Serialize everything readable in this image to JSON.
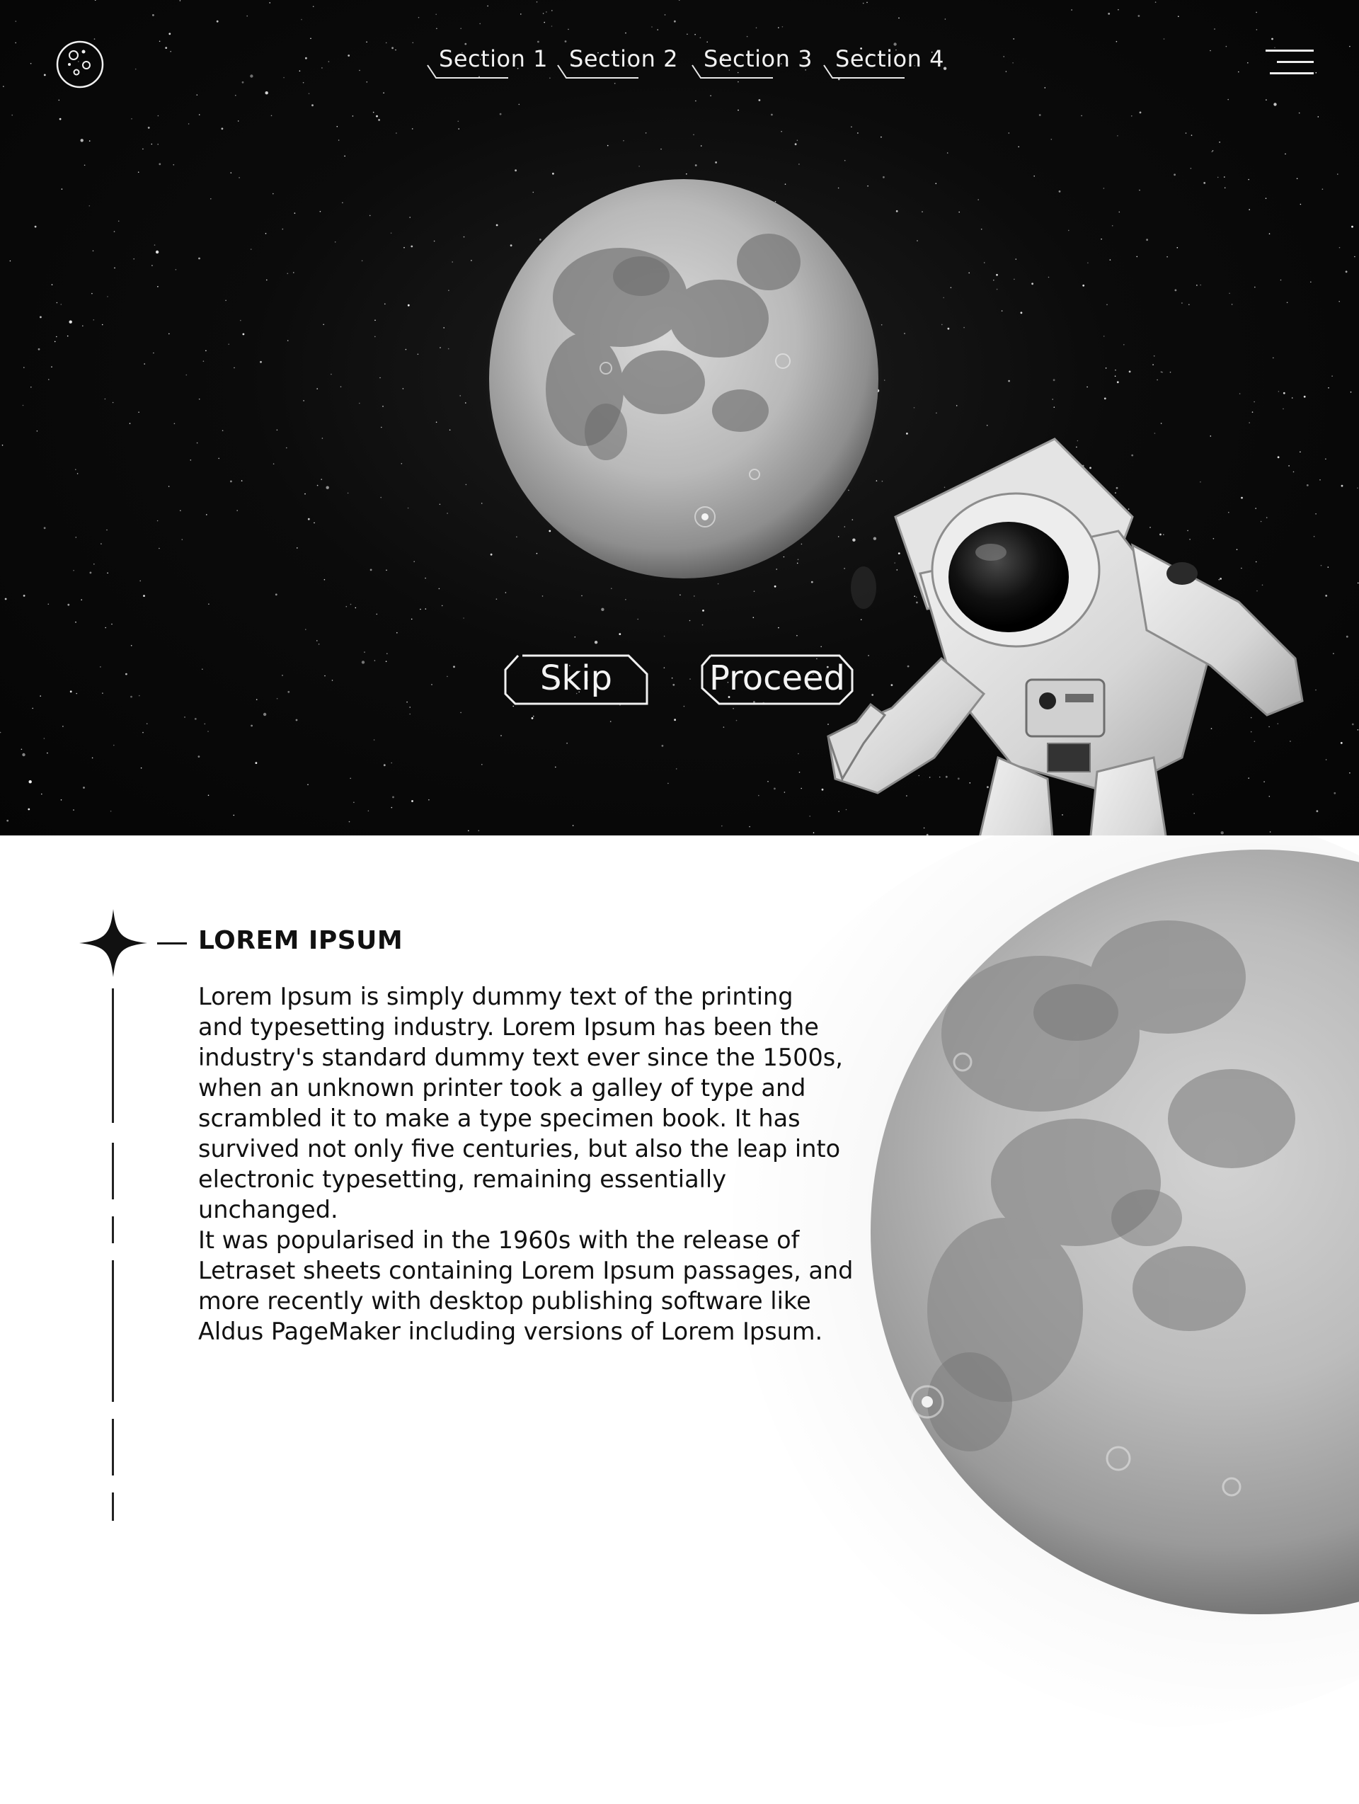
{
  "header": {
    "logo_icon": "moon-logo-icon",
    "nav": [
      {
        "label": "Section 1"
      },
      {
        "label": "Section 2"
      },
      {
        "label": "Section 3"
      },
      {
        "label": "Section 4"
      }
    ],
    "menu_icon": "hamburger-menu-icon"
  },
  "hero": {
    "skip_label": "Skip",
    "proceed_label": "Proceed"
  },
  "article": {
    "heading": "LOREM IPSUM",
    "body": "Lorem Ipsum is simply dummy text of the printing\nand typesetting industry. Lorem Ipsum has been the\nindustry's standard dummy text ever since the 1500s,\nwhen an unknown printer took a galley of type and\nscrambled it to make a type specimen book. It has\nsurvived not only five centuries, but also the leap into\nelectronic typesetting, remaining essentially unchanged.\nIt was popularised in the 1960s with the release of\nLetraset sheets containing Lorem Ipsum passages, and\nmore recently with desktop publishing software like\nAldus PageMaker including versions of Lorem Ipsum."
  },
  "colors": {
    "hero_bg": "#050505",
    "content_bg": "#ffffff",
    "text_dark": "#111111",
    "text_light": "#f2f2f2"
  }
}
